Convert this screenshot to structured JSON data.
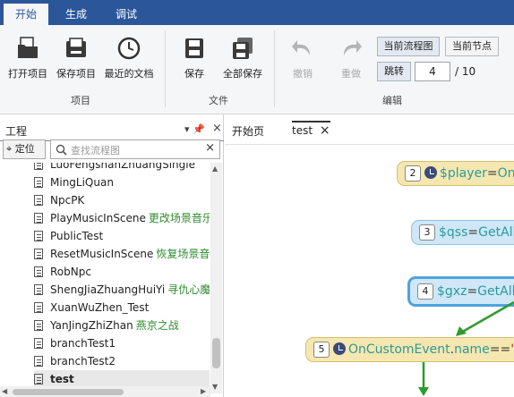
{
  "ribbon_tabs": [
    "开始",
    "生成",
    "调试"
  ],
  "groups": {
    "project": {
      "label": "项目",
      "buttons": [
        "打开项目",
        "保存项目",
        "最近的文档"
      ]
    },
    "file": {
      "label": "文件",
      "buttons": [
        "保存",
        "全部保存"
      ]
    },
    "edit": {
      "label": "编辑",
      "undo": "撤销",
      "redo": "重做",
      "current_flow": "当前流程图",
      "current_node": "当前节点",
      "jump": "跳转",
      "page_value": "4",
      "page_total": "/ 10"
    }
  },
  "left_panel": {
    "title": "工程",
    "pin": "▾ 📌",
    "close": "×",
    "locate": "定位",
    "search_placeholder": "查找流程图",
    "search_clear": "×",
    "items": [
      {
        "name": "LuoFengshanZhuangSingle",
        "cn": ""
      },
      {
        "name": "MingLiQuan",
        "cn": ""
      },
      {
        "name": "NpcPK",
        "cn": ""
      },
      {
        "name": "PlayMusicInScene",
        "cn": "更改场景音乐"
      },
      {
        "name": "PublicTest",
        "cn": ""
      },
      {
        "name": "ResetMusicInScene",
        "cn": "恢复场景音乐"
      },
      {
        "name": "RobNpc",
        "cn": ""
      },
      {
        "name": "ShengJiaZhuangHuiYi",
        "cn": "寻仇心魔"
      },
      {
        "name": "XuanWuZhen_Test",
        "cn": ""
      },
      {
        "name": "YanJingZhiZhan",
        "cn": "燕京之战"
      },
      {
        "name": "branchTest1",
        "cn": ""
      },
      {
        "name": "branchTest2",
        "cn": ""
      },
      {
        "name": "test",
        "cn": ""
      }
    ]
  },
  "doc_tabs": {
    "start_page": "开始页",
    "active": "test",
    "close": "×"
  },
  "nodes": [
    {
      "num": "2",
      "var": "$player",
      "eq": "=",
      "fn": "OnP"
    },
    {
      "num": "3",
      "var": "$qss",
      "eq": "=",
      "fn": "GetAllC"
    },
    {
      "num": "4",
      "var": "$gxz",
      "eq": "=",
      "fn": "GetAllC"
    },
    {
      "num": "5",
      "obj": "OnCustomEvent",
      "dot": ".",
      "field": "name",
      "eq": "==",
      "str": "\"h"
    }
  ],
  "colors": {
    "tabbar": "#2b579a",
    "node_yellow": "#f6e7b0",
    "node_blue": "#cfe7f6",
    "arrow_green": "#2e9b2e",
    "item_cn_green": "#2e8b2e"
  }
}
